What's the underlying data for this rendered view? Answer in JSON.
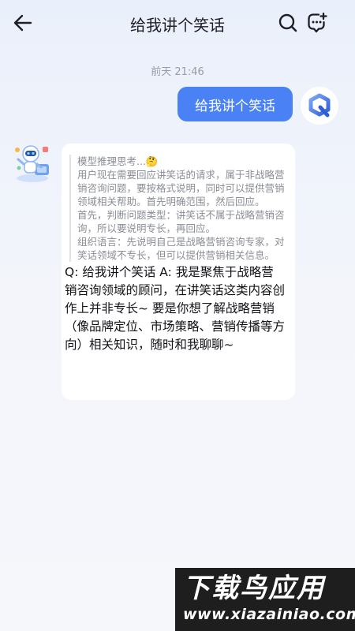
{
  "header": {
    "title": "给我讲个笑话",
    "back_icon": "back-arrow-icon",
    "search_icon": "search-icon",
    "new_chat_icon": "new-chat-icon"
  },
  "conversation": {
    "timestamp": "前天 21:46",
    "user_message": "给我讲个笑话",
    "bot": {
      "thinking_title": "模型推理思考...",
      "thinking_emoji": "🤔",
      "thinking_paragraphs": [
        "用户现在需要回应讲笑话的请求，属于非战略营销咨询问题，要按格式说明，同时可以提供营销领域相关帮助。首先明确范围，然后回应。",
        "首先，判断问题类型：讲笑话不属于战略营销咨询，所以要说明专长，再回应。",
        "组织语言：先说明自己是战略营销咨询专家，对笑话领域不专长，但可以提供营销相关信息。"
      ],
      "answer": "Q: 给我讲个笑话 A: 我是聚焦于战略营销咨询领域的顾问，在讲笑话这类内容创作上并非专长~ 要是你想了解战略营销（像品牌定位、市场策略、营销传播等方向）相关知识，随时和我聊聊~"
    }
  },
  "watermark": {
    "title": "下载鸟应用",
    "url": "www.xiazainiao.com"
  },
  "colors": {
    "accent": "#4a82f5",
    "background": "#eef2fa"
  }
}
